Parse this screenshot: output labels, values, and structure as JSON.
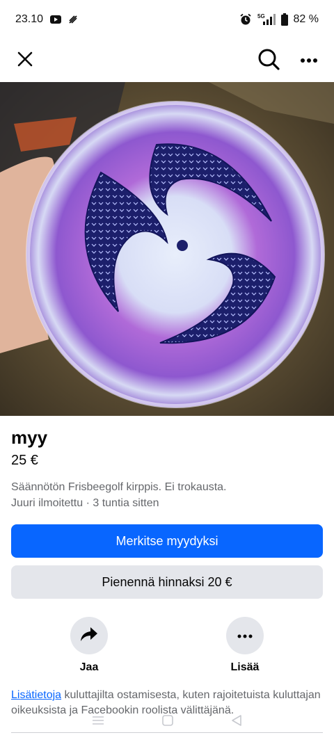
{
  "status_bar": {
    "time": "23.10",
    "battery": "82 %",
    "network": "5G"
  },
  "listing": {
    "title": "myy",
    "price": "25 €",
    "description": "Säännötön Frisbeegolf kirppis. Ei trokausta.",
    "meta": "Juuri ilmoitettu · 3 tuntia sitten"
  },
  "buttons": {
    "mark_sold": "Merkitse myydyksi",
    "reduce_price": "Pienennä hinnaksi 20 €"
  },
  "actions": {
    "share_label": "Jaa",
    "more_label": "Lisää"
  },
  "info": {
    "link_text": "Lisätietoja",
    "text": " kuluttajilta ostamisesta, kuten rajoitetuista kuluttajan oikeuksista ja Facebookin roolista välittäjänä."
  },
  "colors": {
    "primary": "#0866ff",
    "secondary_bg": "#e4e6eb",
    "muted_text": "#65676b"
  },
  "icons": {
    "close": "close-icon",
    "search": "search-icon",
    "more": "more-dots-icon",
    "share": "share-arrow-icon",
    "more_action": "more-dots-icon"
  }
}
